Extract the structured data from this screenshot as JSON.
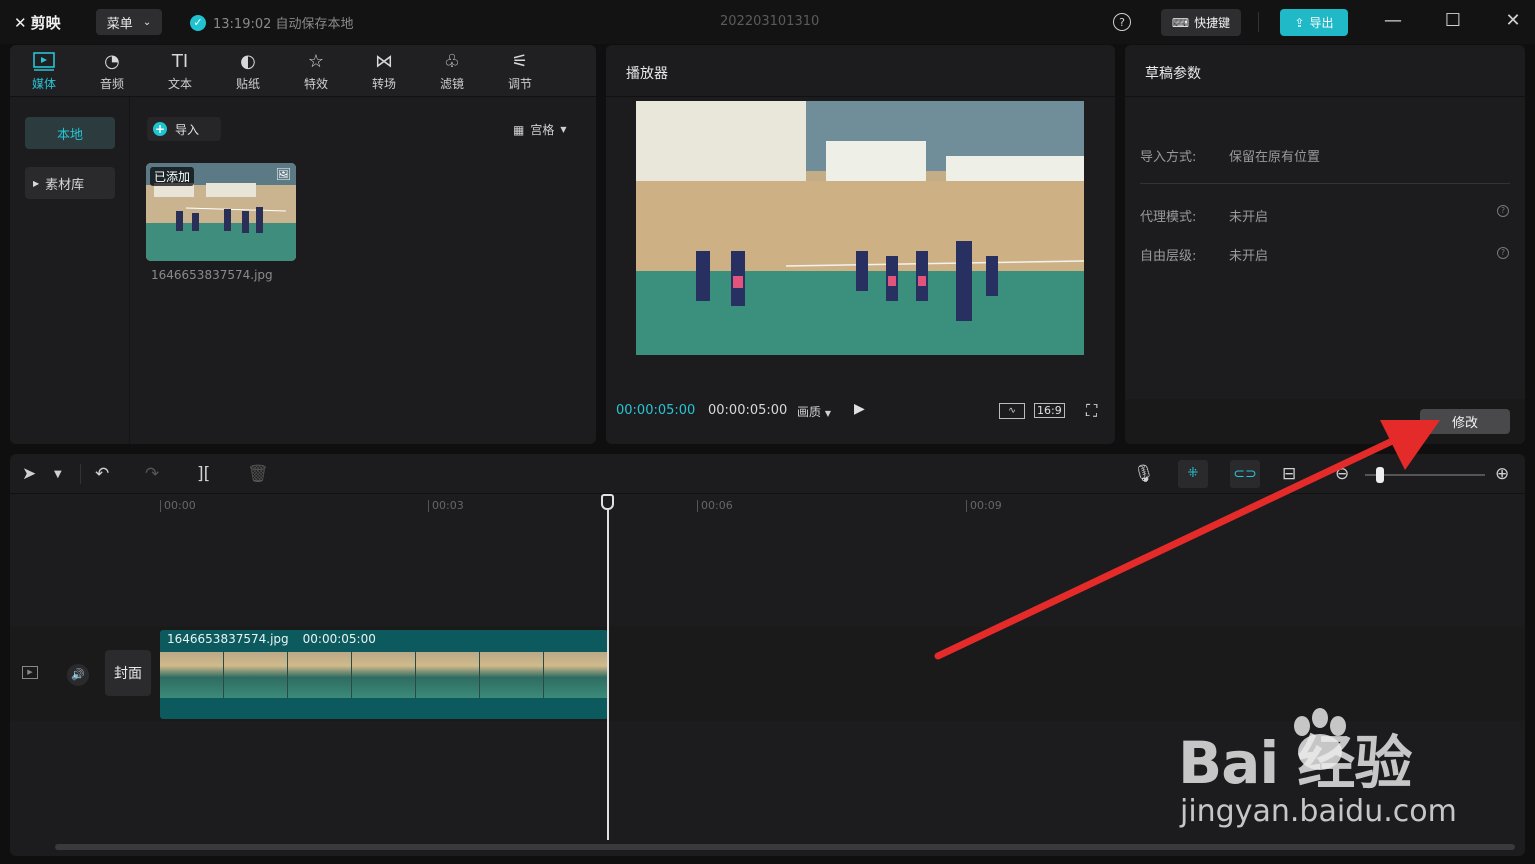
{
  "titlebar": {
    "app_name": "剪映",
    "menu_label": "菜单",
    "autosave": "13:19:02 自动保存本地",
    "project_title": "202203101310",
    "shortcut_label": "快捷键",
    "export_label": "导出"
  },
  "media": {
    "tools": [
      "媒体",
      "音频",
      "文本",
      "贴纸",
      "特效",
      "转场",
      "滤镜",
      "调节"
    ],
    "side_local": "本地",
    "side_library": "素材库",
    "import_label": "导入",
    "view_label": "宫格",
    "thumb_badge": "已添加",
    "thumb_name": "1646653837574.jpg"
  },
  "player": {
    "title": "播放器",
    "time_current": "00:00:05:00",
    "time_total": "00:00:05:00",
    "quality_label": "画质",
    "ratio_label": "16:9"
  },
  "params": {
    "title": "草稿参数",
    "rows": [
      {
        "label": "导入方式:",
        "value": "保留在原有位置"
      },
      {
        "label": "代理模式:",
        "value": "未开启"
      },
      {
        "label": "自由层级:",
        "value": "未开启"
      }
    ],
    "modify_label": "修改"
  },
  "timeline": {
    "ticks": [
      "00:00",
      "00:03",
      "00:06",
      "00:09"
    ],
    "clip_name": "1646653837574.jpg",
    "clip_duration": "00:00:05:00",
    "cover_label": "封面"
  },
  "watermark": {
    "logo_text": "Bai  经验",
    "url": "jingyan.baidu.com"
  },
  "colors": {
    "accent": "#20c3d0",
    "arrow": "#e52a2a"
  }
}
